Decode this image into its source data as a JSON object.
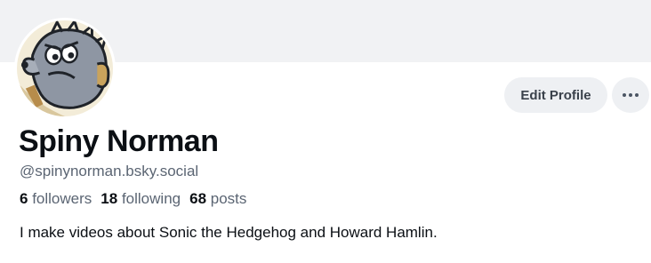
{
  "profile": {
    "display_name": "Spiny Norman",
    "handle": "@spinynorman.bsky.social",
    "bio": "I make videos about Sonic the Hedgehog and Howard Hamlin.",
    "stats": {
      "followers_count": "6",
      "followers_label": "followers",
      "following_count": "18",
      "following_label": "following",
      "posts_count": "68",
      "posts_label": "posts"
    }
  },
  "actions": {
    "edit_profile_label": "Edit Profile",
    "more_icon": "ellipsis-icon"
  },
  "colors": {
    "banner": "#f1f2f4",
    "button_bg": "#eef0f3",
    "text_primary": "#0b0f14",
    "text_secondary": "#5b6573"
  }
}
